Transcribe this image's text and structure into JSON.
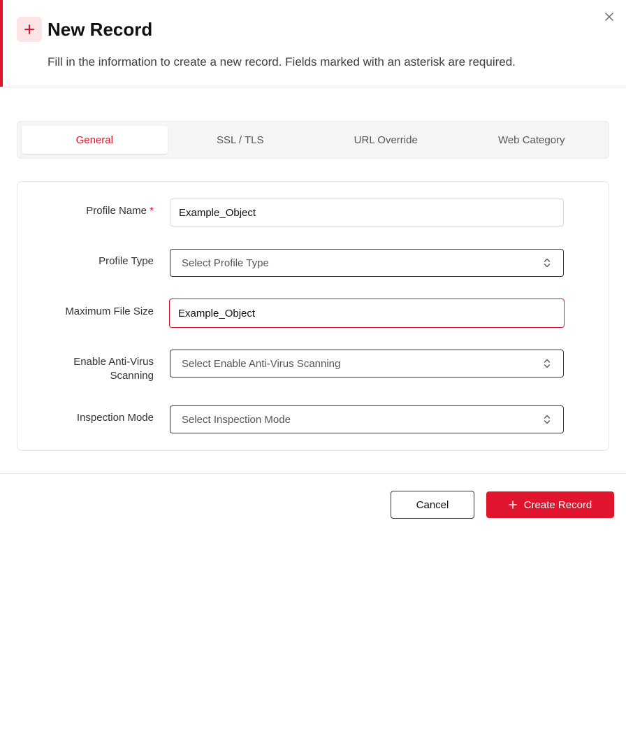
{
  "dialog": {
    "title": "New Record",
    "description": "Fill in the information to create a new record. Fields marked with an asterisk are required.",
    "header_icon": "plus-icon",
    "close_icon": "close-icon"
  },
  "tabs": [
    {
      "label": "General",
      "active": true
    },
    {
      "label": "SSL / TLS",
      "active": false
    },
    {
      "label": "URL Override",
      "active": false
    },
    {
      "label": "Web Category",
      "active": false
    }
  ],
  "form": {
    "profile_name": {
      "label": "Profile Name",
      "required_mark": "*",
      "value": "Example_Object"
    },
    "profile_type": {
      "label": "Profile Type",
      "placeholder": "Select Profile Type"
    },
    "max_file_size": {
      "label": "Maximum File Size",
      "value": "Example_Object"
    },
    "anti_virus": {
      "label_line1": "Enable Anti-Virus",
      "label_line2": "Scanning",
      "placeholder": "Select Enable Anti-Virus Scanning"
    },
    "inspection_mode": {
      "label": "Inspection Mode",
      "placeholder": "Select Inspection Mode"
    }
  },
  "footer": {
    "cancel_label": "Cancel",
    "create_label": "Create Record"
  },
  "colors": {
    "accent": "#e0142c",
    "accent_light": "#fde4e6",
    "border": "#e6e6e6"
  }
}
